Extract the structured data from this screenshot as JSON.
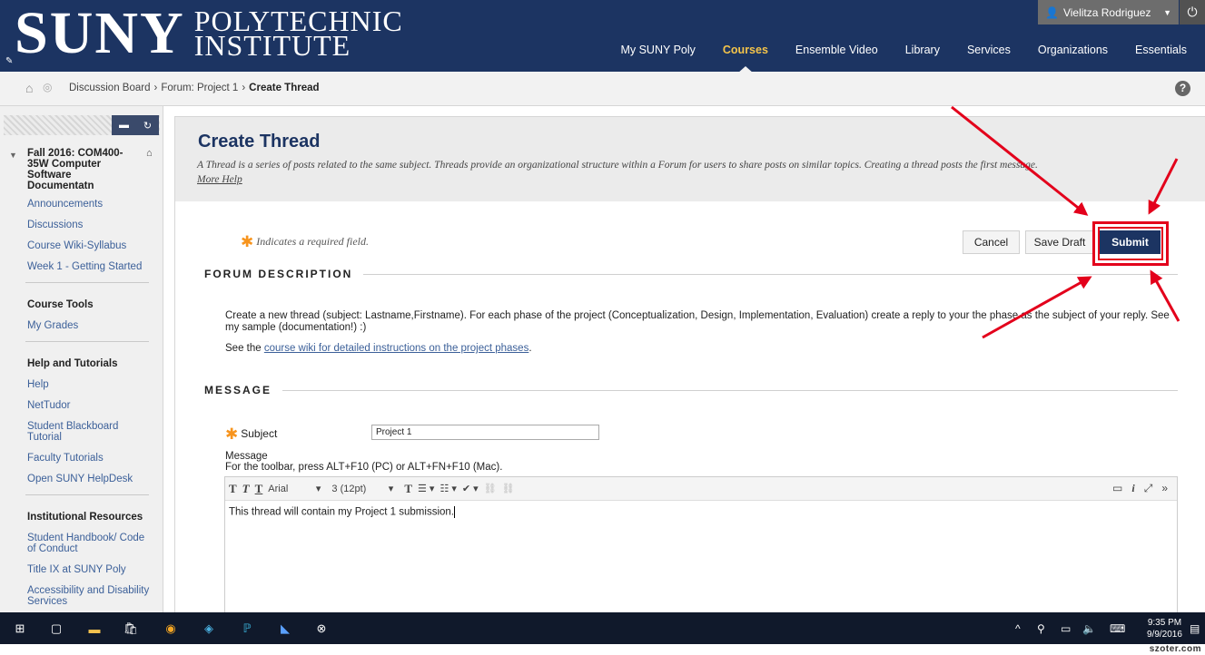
{
  "header": {
    "logo_main": "SUNY",
    "logo_line1": "POLYTECHNIC",
    "logo_line2": "INSTITUTE",
    "user_name": "Vielitza Rodriguez",
    "nav": [
      "My SUNY Poly",
      "Courses",
      "Ensemble Video",
      "Library",
      "Services",
      "Organizations",
      "Essentials"
    ],
    "active_nav": "Courses"
  },
  "breadcrumb": {
    "items": [
      "Discussion Board",
      "Forum: Project 1",
      "Create Thread"
    ],
    "help": "?"
  },
  "sidebar": {
    "course_title": "Fall 2016: COM400-35W Computer Software Documentatn",
    "course_links": [
      "Announcements",
      "Discussions",
      "Course Wiki-Syllabus",
      "Week 1 - Getting Started"
    ],
    "tools_heading": "Course Tools",
    "tools_links": [
      "My Grades"
    ],
    "help_heading": "Help and Tutorials",
    "help_links": [
      "Help",
      "NetTudor",
      "Student Blackboard Tutorial",
      "Faculty Tutorials",
      "Open SUNY HelpDesk"
    ],
    "inst_heading": "Institutional Resources",
    "inst_links": [
      "Student Handbook/ Code of Conduct",
      "Title IX at SUNY Poly",
      "Accessibility and Disability Services"
    ]
  },
  "page": {
    "title": "Create Thread",
    "description": "A Thread is a series of posts related to the same subject. Threads provide an organizational structure within a Forum for users to share posts on similar topics. Creating a thread posts the first message.",
    "more_help": "More Help",
    "required_note": "Indicates a required field.",
    "buttons": {
      "cancel": "Cancel",
      "save_draft": "Save Draft",
      "submit": "Submit"
    },
    "forum_section": "FORUM DESCRIPTION",
    "forum_text": "Create a new thread (subject: Lastname,Firstname). For each phase of the project (Conceptualization, Design, Implementation, Evaluation) create a reply to your the phase as the subject of your reply. See my sample (documentation!) :)",
    "see_prefix": "See the ",
    "see_link": "course wiki for detailed instructions on the project phases",
    "see_suffix": ".",
    "message_section": "MESSAGE",
    "subject_label": "Subject",
    "subject_value": "Project 1",
    "message_label": "Message",
    "toolbar_hint": "For the toolbar, press ALT+F10 (PC) or ALT+FN+F10 (Mac).",
    "font_family": "Arial",
    "font_size": "3 (12pt)",
    "message_body": "This thread will contain my Project 1 submission."
  },
  "taskbar": {
    "time": "9:35 PM",
    "date": "9/9/2016"
  },
  "watermark": "szoter.com",
  "colors": {
    "header": "#1c3462",
    "accent": "#f4c44a",
    "annotation": "#e3001b"
  }
}
